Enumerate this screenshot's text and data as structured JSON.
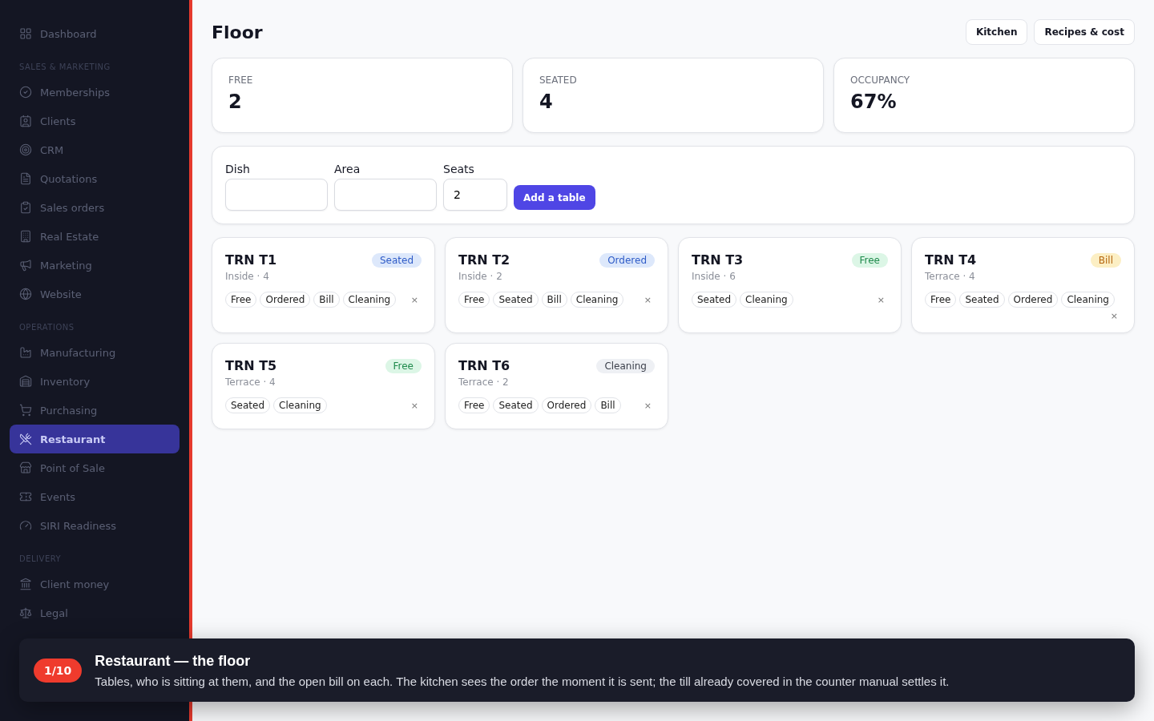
{
  "sidebar": {
    "sections": [
      {
        "items": [
          {
            "label": "Dashboard",
            "selected": false
          }
        ]
      },
      {
        "heading": "SALES & MARKETING",
        "items": [
          {
            "label": "Memberships",
            "selected": false
          },
          {
            "label": "Clients",
            "selected": false
          },
          {
            "label": "CRM",
            "selected": false
          },
          {
            "label": "Quotations",
            "selected": false
          },
          {
            "label": "Sales orders",
            "selected": false
          },
          {
            "label": "Real Estate",
            "selected": false
          },
          {
            "label": "Marketing",
            "selected": false
          },
          {
            "label": "Website",
            "selected": false
          }
        ]
      },
      {
        "heading": "OPERATIONS",
        "items": [
          {
            "label": "Manufacturing",
            "selected": false
          },
          {
            "label": "Inventory",
            "selected": false
          },
          {
            "label": "Purchasing",
            "selected": false
          },
          {
            "label": "Restaurant",
            "selected": true
          },
          {
            "label": "Point of Sale",
            "selected": false
          },
          {
            "label": "Events",
            "selected": false
          },
          {
            "label": "SIRI Readiness",
            "selected": false
          }
        ]
      },
      {
        "heading": "DELIVERY",
        "items": [
          {
            "label": "Client money",
            "selected": false
          },
          {
            "label": "Legal",
            "selected": false
          }
        ]
      }
    ]
  },
  "page": {
    "title": "Floor",
    "actions": [
      "Kitchen",
      "Recipes & cost"
    ]
  },
  "stats": [
    {
      "label": "FREE",
      "value": "2"
    },
    {
      "label": "SEATED",
      "value": "4"
    },
    {
      "label": "OCCUPANCY",
      "value": "67%"
    }
  ],
  "form": {
    "fields": [
      {
        "label": "Dish"
      },
      {
        "label": "Area"
      },
      {
        "label": "Seats",
        "value": "2"
      }
    ],
    "submit": "Add a table"
  },
  "tables": [
    {
      "name": "TRN T1",
      "meta": "Inside · 4",
      "status": {
        "label": "Seated",
        "kind": "seated"
      },
      "actions": [
        "Free",
        "Ordered",
        "Bill",
        "Cleaning"
      ],
      "close": "×"
    },
    {
      "name": "TRN T2",
      "meta": "Inside · 2",
      "status": {
        "label": "Ordered",
        "kind": "ordered"
      },
      "actions": [
        "Free",
        "Seated",
        "Bill",
        "Cleaning"
      ],
      "close": "×"
    },
    {
      "name": "TRN T3",
      "meta": "Inside · 6",
      "status": {
        "label": "Free",
        "kind": "free"
      },
      "actions": [
        "Seated",
        "Cleaning"
      ],
      "close": "×"
    },
    {
      "name": "TRN T4",
      "meta": "Terrace · 4",
      "status": {
        "label": "Bill",
        "kind": "bill"
      },
      "actions": [
        "Free",
        "Seated",
        "Ordered",
        "Cleaning"
      ],
      "close": "×"
    },
    {
      "name": "TRN T5",
      "meta": "Terrace · 4",
      "status": {
        "label": "Free",
        "kind": "free"
      },
      "actions": [
        "Seated",
        "Cleaning"
      ],
      "close": "×"
    },
    {
      "name": "TRN T6",
      "meta": "Terrace · 2",
      "status": {
        "label": "Cleaning",
        "kind": "cleaning"
      },
      "actions": [
        "Free",
        "Seated",
        "Ordered",
        "Bill"
      ],
      "close": "×"
    }
  ],
  "tour": {
    "step": "1/10",
    "title": "Restaurant — the floor",
    "text": "Tables, who is sitting at them, and the open bill on each. The kitchen sees the order the moment it is sent; the till already covered in the counter manual settles it."
  }
}
